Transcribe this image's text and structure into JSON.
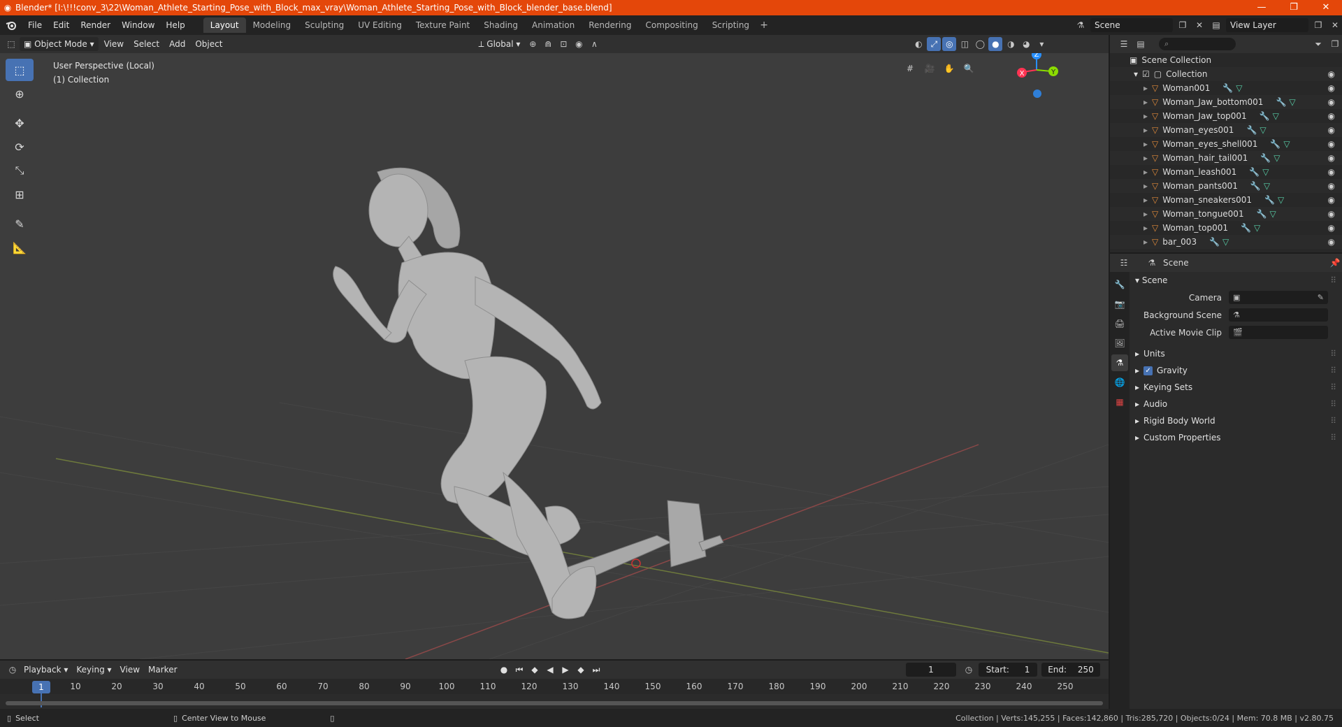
{
  "window": {
    "title": "Blender* [I:\\!!!conv_3\\22\\Woman_Athlete_Starting_Pose_with_Block_max_vray\\Woman_Athlete_Starting_Pose_with_Block_blender_base.blend]",
    "controls": [
      "—",
      "❐",
      "✕"
    ]
  },
  "menus": [
    "File",
    "Edit",
    "Render",
    "Window",
    "Help"
  ],
  "workspaces": [
    {
      "label": "Layout",
      "active": true
    },
    {
      "label": "Modeling"
    },
    {
      "label": "Sculpting"
    },
    {
      "label": "UV Editing"
    },
    {
      "label": "Texture Paint"
    },
    {
      "label": "Shading"
    },
    {
      "label": "Animation"
    },
    {
      "label": "Rendering"
    },
    {
      "label": "Compositing"
    },
    {
      "label": "Scripting"
    }
  ],
  "scene_selector": "Scene",
  "view_layer_selector": "View Layer",
  "viewport_header": {
    "mode": "Object Mode",
    "menus": [
      "View",
      "Select",
      "Add",
      "Object"
    ],
    "orientation": "Global"
  },
  "viewport": {
    "perspective_label": "User Perspective (Local)",
    "collection_label": "(1) Collection",
    "gizmo_axes": [
      "X",
      "Y",
      "Z"
    ],
    "colors": {
      "x_axis": "#ff3352",
      "y_axis": "#8bdc00",
      "z_axis": "#2890ff",
      "background": "#3d3d3d"
    }
  },
  "outliner": {
    "root": "Scene Collection",
    "collection": "Collection",
    "objects": [
      "Woman001",
      "Woman_Jaw_bottom001",
      "Woman_Jaw_top001",
      "Woman_eyes001",
      "Woman_eyes_shell001",
      "Woman_hair_tail001",
      "Woman_leash001",
      "Woman_pants001",
      "Woman_sneakers001",
      "Woman_tongue001",
      "Woman_top001",
      "bar_003"
    ]
  },
  "properties": {
    "header_title": "Scene",
    "panel_title": "Scene",
    "fields": [
      {
        "label": "Camera"
      },
      {
        "label": "Background Scene"
      },
      {
        "label": "Active Movie Clip"
      }
    ],
    "subpanels": [
      {
        "label": "Units"
      },
      {
        "label": "Gravity",
        "checked": true
      },
      {
        "label": "Keying Sets"
      },
      {
        "label": "Audio"
      },
      {
        "label": "Rigid Body World"
      },
      {
        "label": "Custom Properties"
      }
    ]
  },
  "timeline": {
    "menus": [
      "Playback",
      "Keying",
      "View",
      "Marker"
    ],
    "current_frame": "1",
    "start_label": "Start:",
    "start": "1",
    "end_label": "End:",
    "end": "250",
    "ticks": [
      "1",
      "10",
      "20",
      "30",
      "40",
      "50",
      "60",
      "70",
      "80",
      "90",
      "100",
      "110",
      "120",
      "130",
      "140",
      "150",
      "160",
      "170",
      "180",
      "190",
      "200",
      "210",
      "220",
      "230",
      "240",
      "250"
    ]
  },
  "statusbar": {
    "select": "Select",
    "center_view": "Center View to Mouse",
    "stats": "Collection | Verts:145,255 | Faces:142,860 | Tris:285,720 | Objects:0/24 | Mem: 70.8 MB | v2.80.75"
  }
}
